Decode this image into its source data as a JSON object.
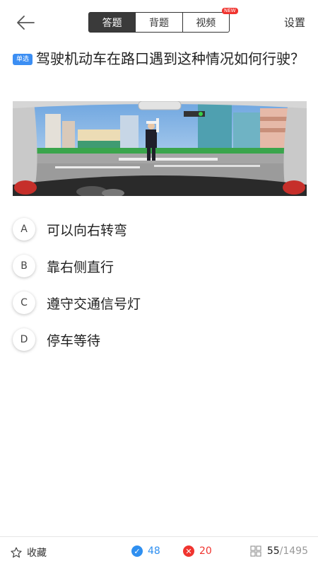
{
  "header": {
    "tabs": [
      {
        "label": "答题",
        "active": true
      },
      {
        "label": "背题",
        "active": false
      },
      {
        "label": "视频",
        "active": false
      }
    ],
    "new_badge": "NEW",
    "settings_label": "设置"
  },
  "question": {
    "type_badge": "单选",
    "text": "驾驶机动车在路口遇到这种情况如何行驶？"
  },
  "options": [
    {
      "letter": "A",
      "text": "可以向右转弯"
    },
    {
      "letter": "B",
      "text": "靠右侧直行"
    },
    {
      "letter": "C",
      "text": "遵守交通信号灯"
    },
    {
      "letter": "D",
      "text": "停车等待"
    }
  ],
  "bottom_bar": {
    "favorite_label": "收藏",
    "correct_count": "48",
    "wrong_count": "20",
    "current_index": "55",
    "total_label": "/1495"
  },
  "colors": {
    "accent_blue": "#2f8ff0",
    "error_red": "#f0342f",
    "tab_active_bg": "#3a3a3a"
  },
  "icons": [
    "back-arrow-icon",
    "star-icon",
    "check-icon",
    "x-icon",
    "grid-icon"
  ]
}
